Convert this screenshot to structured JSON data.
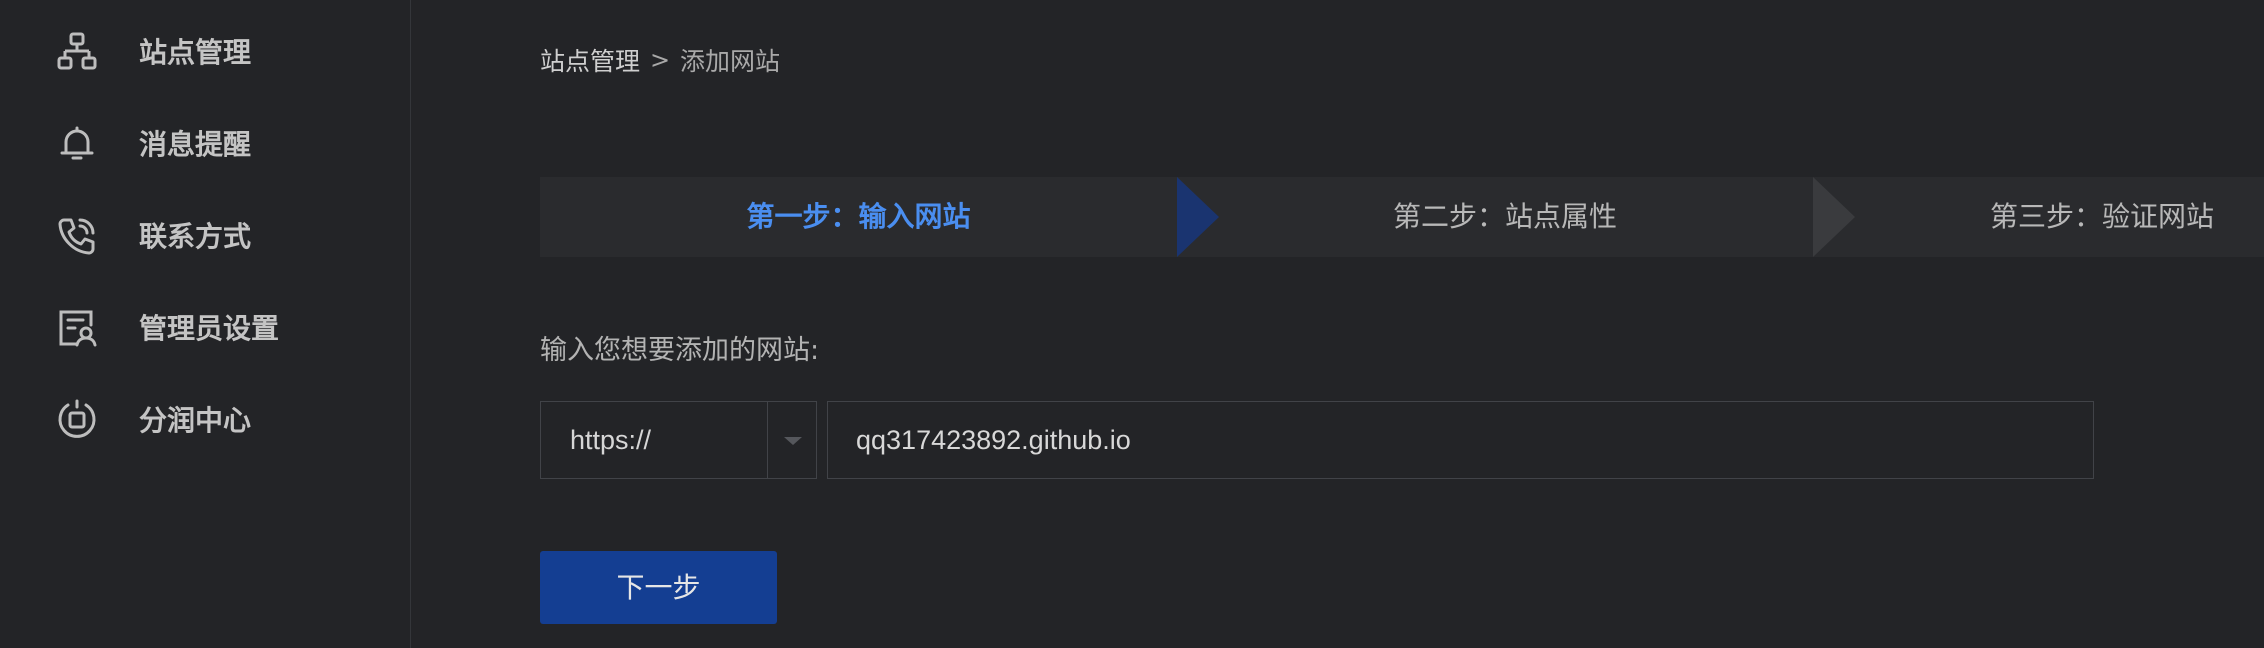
{
  "sidebar": {
    "items": [
      {
        "label": "站点管理",
        "icon": "sitemap-icon"
      },
      {
        "label": "消息提醒",
        "icon": "bell-icon"
      },
      {
        "label": "联系方式",
        "icon": "phone-icon"
      },
      {
        "label": "管理员设置",
        "icon": "admin-settings-icon"
      },
      {
        "label": "分润中心",
        "icon": "profit-share-icon"
      }
    ]
  },
  "breadcrumb": {
    "root": "站点管理",
    "separator": ">",
    "current": "添加网站"
  },
  "steps": [
    {
      "label": "第一步：输入网站",
      "active": true
    },
    {
      "label": "第二步：站点属性",
      "active": false
    },
    {
      "label": "第三步：验证网站",
      "active": false
    }
  ],
  "form": {
    "label": "输入您想要添加的网站:",
    "protocol": "https://",
    "url_value": "qq317423892.github.io",
    "next_label": "下一步"
  },
  "colors": {
    "background": "#232427",
    "active_step": "#4a8ef0",
    "primary_button": "#143e92"
  }
}
